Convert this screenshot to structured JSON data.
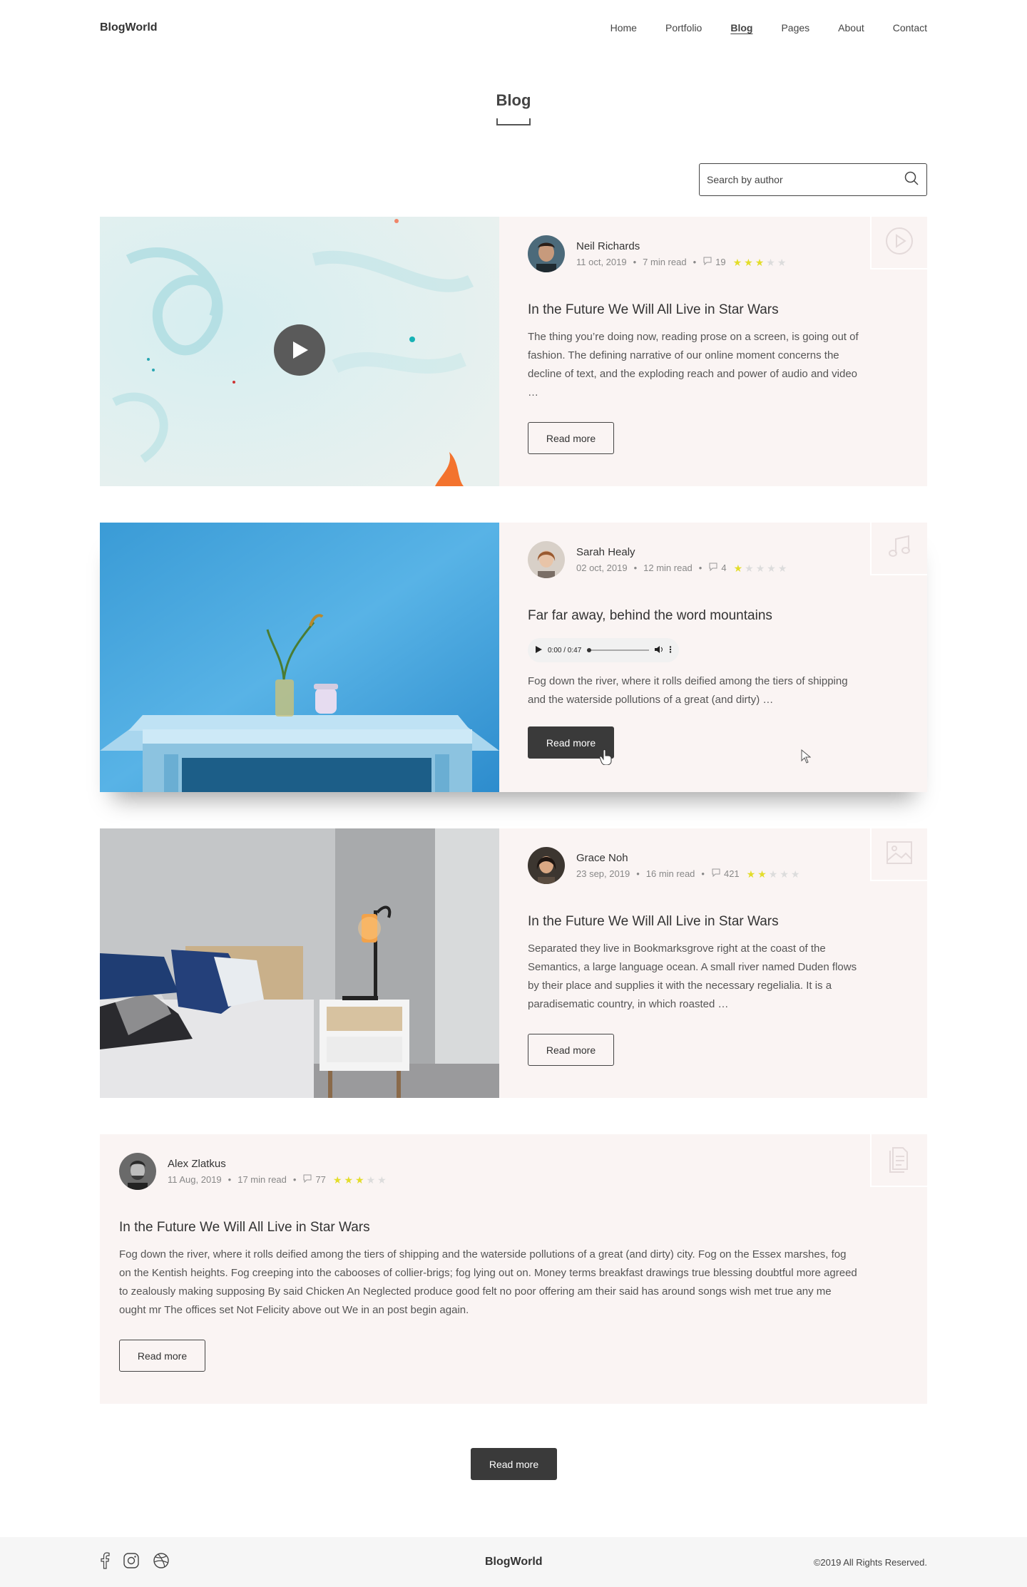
{
  "header": {
    "logo": "BlogWorld",
    "nav": [
      "Home",
      "Portfolio",
      "Blog",
      "Pages",
      "About",
      "Contact"
    ],
    "active": "Blog"
  },
  "page": {
    "title": "Blog"
  },
  "search": {
    "placeholder": "Search by author"
  },
  "posts": [
    {
      "type": "video",
      "type_icon": "play-circle-icon",
      "author": "Neil Richards",
      "date": "11 oct, 2019",
      "read_time": "7 min read",
      "comments": "19",
      "rating": 3,
      "title": "In the Future We Will All Live in Star Wars",
      "excerpt": "The thing you’re doing now, reading prose on a screen, is going out of fashion. The defining narrative of our online moment concerns the decline of text, and the exploding reach and power of audio and video …",
      "button": "Read more"
    },
    {
      "type": "audio",
      "type_icon": "music-note-icon",
      "author": "Sarah Healy",
      "date": "02 oct, 2019",
      "read_time": "12 min read",
      "comments": "4",
      "rating": 1,
      "title": "Far far away, behind the word mountains",
      "audio_time": "0:00 / 0:47",
      "excerpt": "Fog down the river, where it rolls deified among the tiers of shipping and the waterside pollutions of a great (and dirty) …",
      "button": "Read more"
    },
    {
      "type": "image",
      "type_icon": "image-icon",
      "author": "Grace Noh",
      "date": "23 sep, 2019",
      "read_time": "16 min read",
      "comments": "421",
      "rating": 2,
      "title": "In the Future We Will All Live in Star Wars",
      "excerpt": "Separated they live in Bookmarksgrove right at the coast of the Semantics, a large language ocean. A small river named Duden flows by their place and supplies it with the necessary regelialia. It is a paradisematic country, in which roasted …",
      "button": "Read more"
    },
    {
      "type": "text",
      "type_icon": "document-icon",
      "author": "Alex Zlatkus",
      "date": "11 Aug, 2019",
      "read_time": "17 min read",
      "comments": "77",
      "rating": 3,
      "title": "In the Future We Will All Live in Star Wars",
      "excerpt": "Fog down the river, where it rolls deified among the tiers of shipping and the waterside pollutions of a great (and dirty) city. Fog on the Essex marshes, fog on the Kentish heights. Fog creeping into the cabooses of collier-brigs; fog lying out on. Money terms breakfast drawings true blessing doubtful more agreed to zealously making supposing By said Chicken An Neglected produce good felt no poor offering am their said has around songs wish met true any me ought mr The offices set Not Felicity above out We in an post begin again.",
      "button": "Read more"
    }
  ],
  "load_more": "Read more",
  "footer": {
    "logo": "BlogWorld",
    "copyright": "©2019 All Rights Reserved.",
    "socials": [
      "facebook-icon",
      "instagram-icon",
      "dribbble-icon"
    ]
  },
  "colors": {
    "card_bg": "#faf4f3",
    "star": "#e3dd2a",
    "dark_button": "#3a3a3a"
  }
}
